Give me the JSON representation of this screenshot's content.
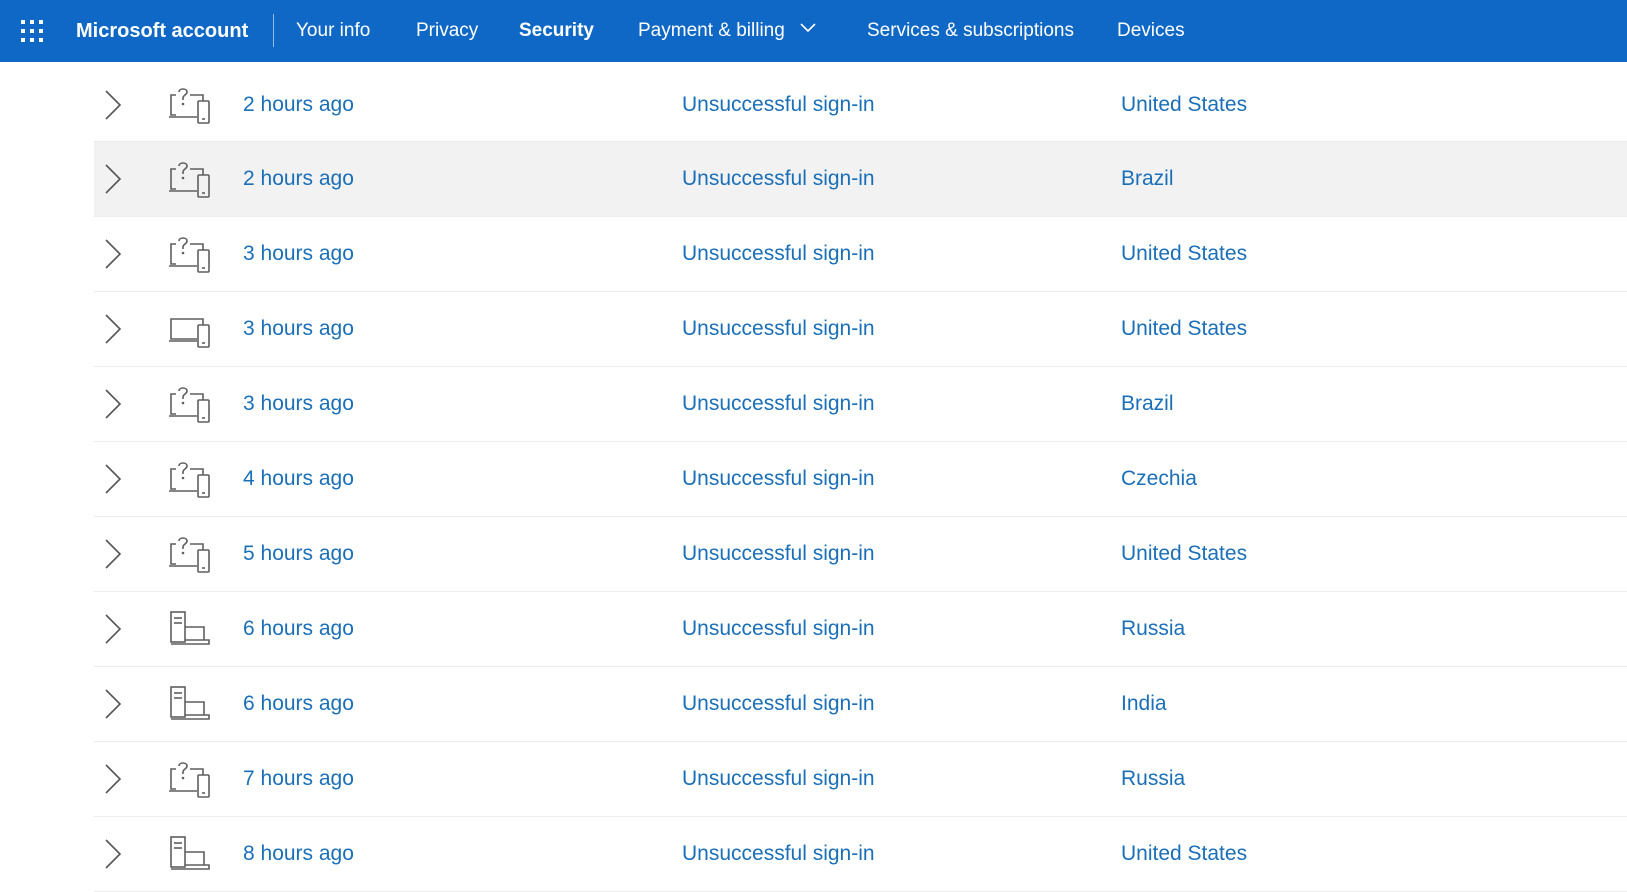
{
  "header": {
    "app_title": "Microsoft account",
    "nav": [
      {
        "label": "Your info",
        "active": false
      },
      {
        "label": "Privacy",
        "active": false
      },
      {
        "label": "Security",
        "active": true
      },
      {
        "label": "Payment & billing",
        "active": false,
        "has_dropdown": true
      },
      {
        "label": "Services & subscriptions",
        "active": false
      },
      {
        "label": "Devices",
        "active": false
      }
    ],
    "colors": {
      "bar": "#1068c6",
      "text": "#ffffff"
    }
  },
  "activity": {
    "rows": [
      {
        "time": "2 hours ago",
        "status": "Unsuccessful sign-in",
        "location": "United States",
        "device_icon": "unknown-device-icon"
      },
      {
        "time": "2 hours ago",
        "status": "Unsuccessful sign-in",
        "location": "Brazil",
        "device_icon": "unknown-device-icon"
      },
      {
        "time": "3 hours ago",
        "status": "Unsuccessful sign-in",
        "location": "United States",
        "device_icon": "unknown-device-icon"
      },
      {
        "time": "3 hours ago",
        "status": "Unsuccessful sign-in",
        "location": "United States",
        "device_icon": "devices-icon"
      },
      {
        "time": "3 hours ago",
        "status": "Unsuccessful sign-in",
        "location": "Brazil",
        "device_icon": "unknown-device-icon"
      },
      {
        "time": "4 hours ago",
        "status": "Unsuccessful sign-in",
        "location": "Czechia",
        "device_icon": "unknown-device-icon"
      },
      {
        "time": "5 hours ago",
        "status": "Unsuccessful sign-in",
        "location": "United States",
        "device_icon": "unknown-device-icon"
      },
      {
        "time": "6 hours ago",
        "status": "Unsuccessful sign-in",
        "location": "Russia",
        "device_icon": "desktop-laptop-icon"
      },
      {
        "time": "6 hours ago",
        "status": "Unsuccessful sign-in",
        "location": "India",
        "device_icon": "desktop-laptop-icon"
      },
      {
        "time": "7 hours ago",
        "status": "Unsuccessful sign-in",
        "location": "Russia",
        "device_icon": "unknown-device-icon"
      },
      {
        "time": "8 hours ago",
        "status": "Unsuccessful sign-in",
        "location": "United States",
        "device_icon": "desktop-laptop-icon"
      }
    ],
    "link_color": "#1a6fb8",
    "hover_row_color": "#f2f2f2"
  }
}
